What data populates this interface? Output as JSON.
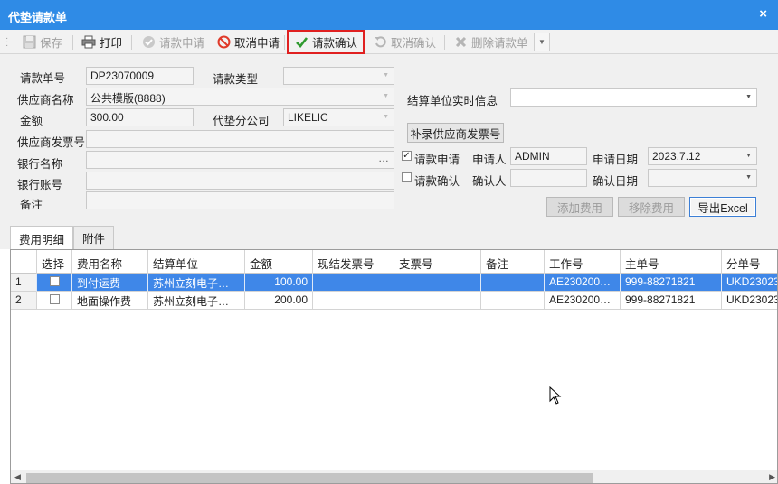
{
  "window": {
    "title": "代垫请款单",
    "close_glyph": "×"
  },
  "toolbar": {
    "save": "保存",
    "print": "打印",
    "request": "请款申请",
    "cancel_request": "取消申请",
    "confirm": "请款确认",
    "cancel_confirm": "取消确认",
    "delete": "删除请款单"
  },
  "form": {
    "request_no_label": "请款单号",
    "request_no": "DP23070009",
    "request_type_label": "请款类型",
    "request_type": "",
    "supplier_label": "供应商名称",
    "supplier": "公共模版(8888)",
    "settlement_info_label": "结算单位实时信息",
    "settlement_info": "",
    "amount_label": "金额",
    "amount": "300.00",
    "branch_label": "代垫分公司",
    "branch": "LIKELIC",
    "supplier_invoice_label": "供应商发票号",
    "supplier_invoice": "",
    "add_invoice_button": "补录供应商发票号",
    "bank_name_label": "银行名称",
    "bank_name": "",
    "bank_account_label": "银行账号",
    "bank_account": "",
    "remark_label": "备注",
    "remark": "",
    "request_check_label": "请款申请",
    "confirm_check_label": "请款确认",
    "applicant_label": "申请人",
    "applicant": "ADMIN",
    "apply_date_label": "申请日期",
    "apply_date": "2023.7.12",
    "confirmer_label": "确认人",
    "confirmer": "",
    "confirm_date_label": "确认日期",
    "confirm_date": "",
    "add_fee_button": "添加费用",
    "remove_fee_button": "移除费用",
    "export_button": "导出Excel",
    "request_checked": true,
    "confirm_checked": false
  },
  "tabs": {
    "fees": "费用明细",
    "attachments": "附件"
  },
  "grid": {
    "columns": [
      "选择",
      "费用名称",
      "结算单位",
      "金额",
      "现结发票号",
      "支票号",
      "备注",
      "工作号",
      "主单号",
      "分单号"
    ],
    "rows": [
      {
        "no": "1",
        "fee": "到付运费",
        "unit": "苏州立刻电子…",
        "amount": "100.00",
        "invoice": "",
        "cheque": "",
        "remark": "",
        "job": "AE230200…",
        "mawb": "999-88271821",
        "hawb": "UKD23023"
      },
      {
        "no": "2",
        "fee": "地面操作费",
        "unit": "苏州立刻电子…",
        "amount": "200.00",
        "invoice": "",
        "cheque": "",
        "remark": "",
        "job": "AE230200…",
        "mawb": "999-88271821",
        "hawb": "UKD23023"
      }
    ]
  }
}
